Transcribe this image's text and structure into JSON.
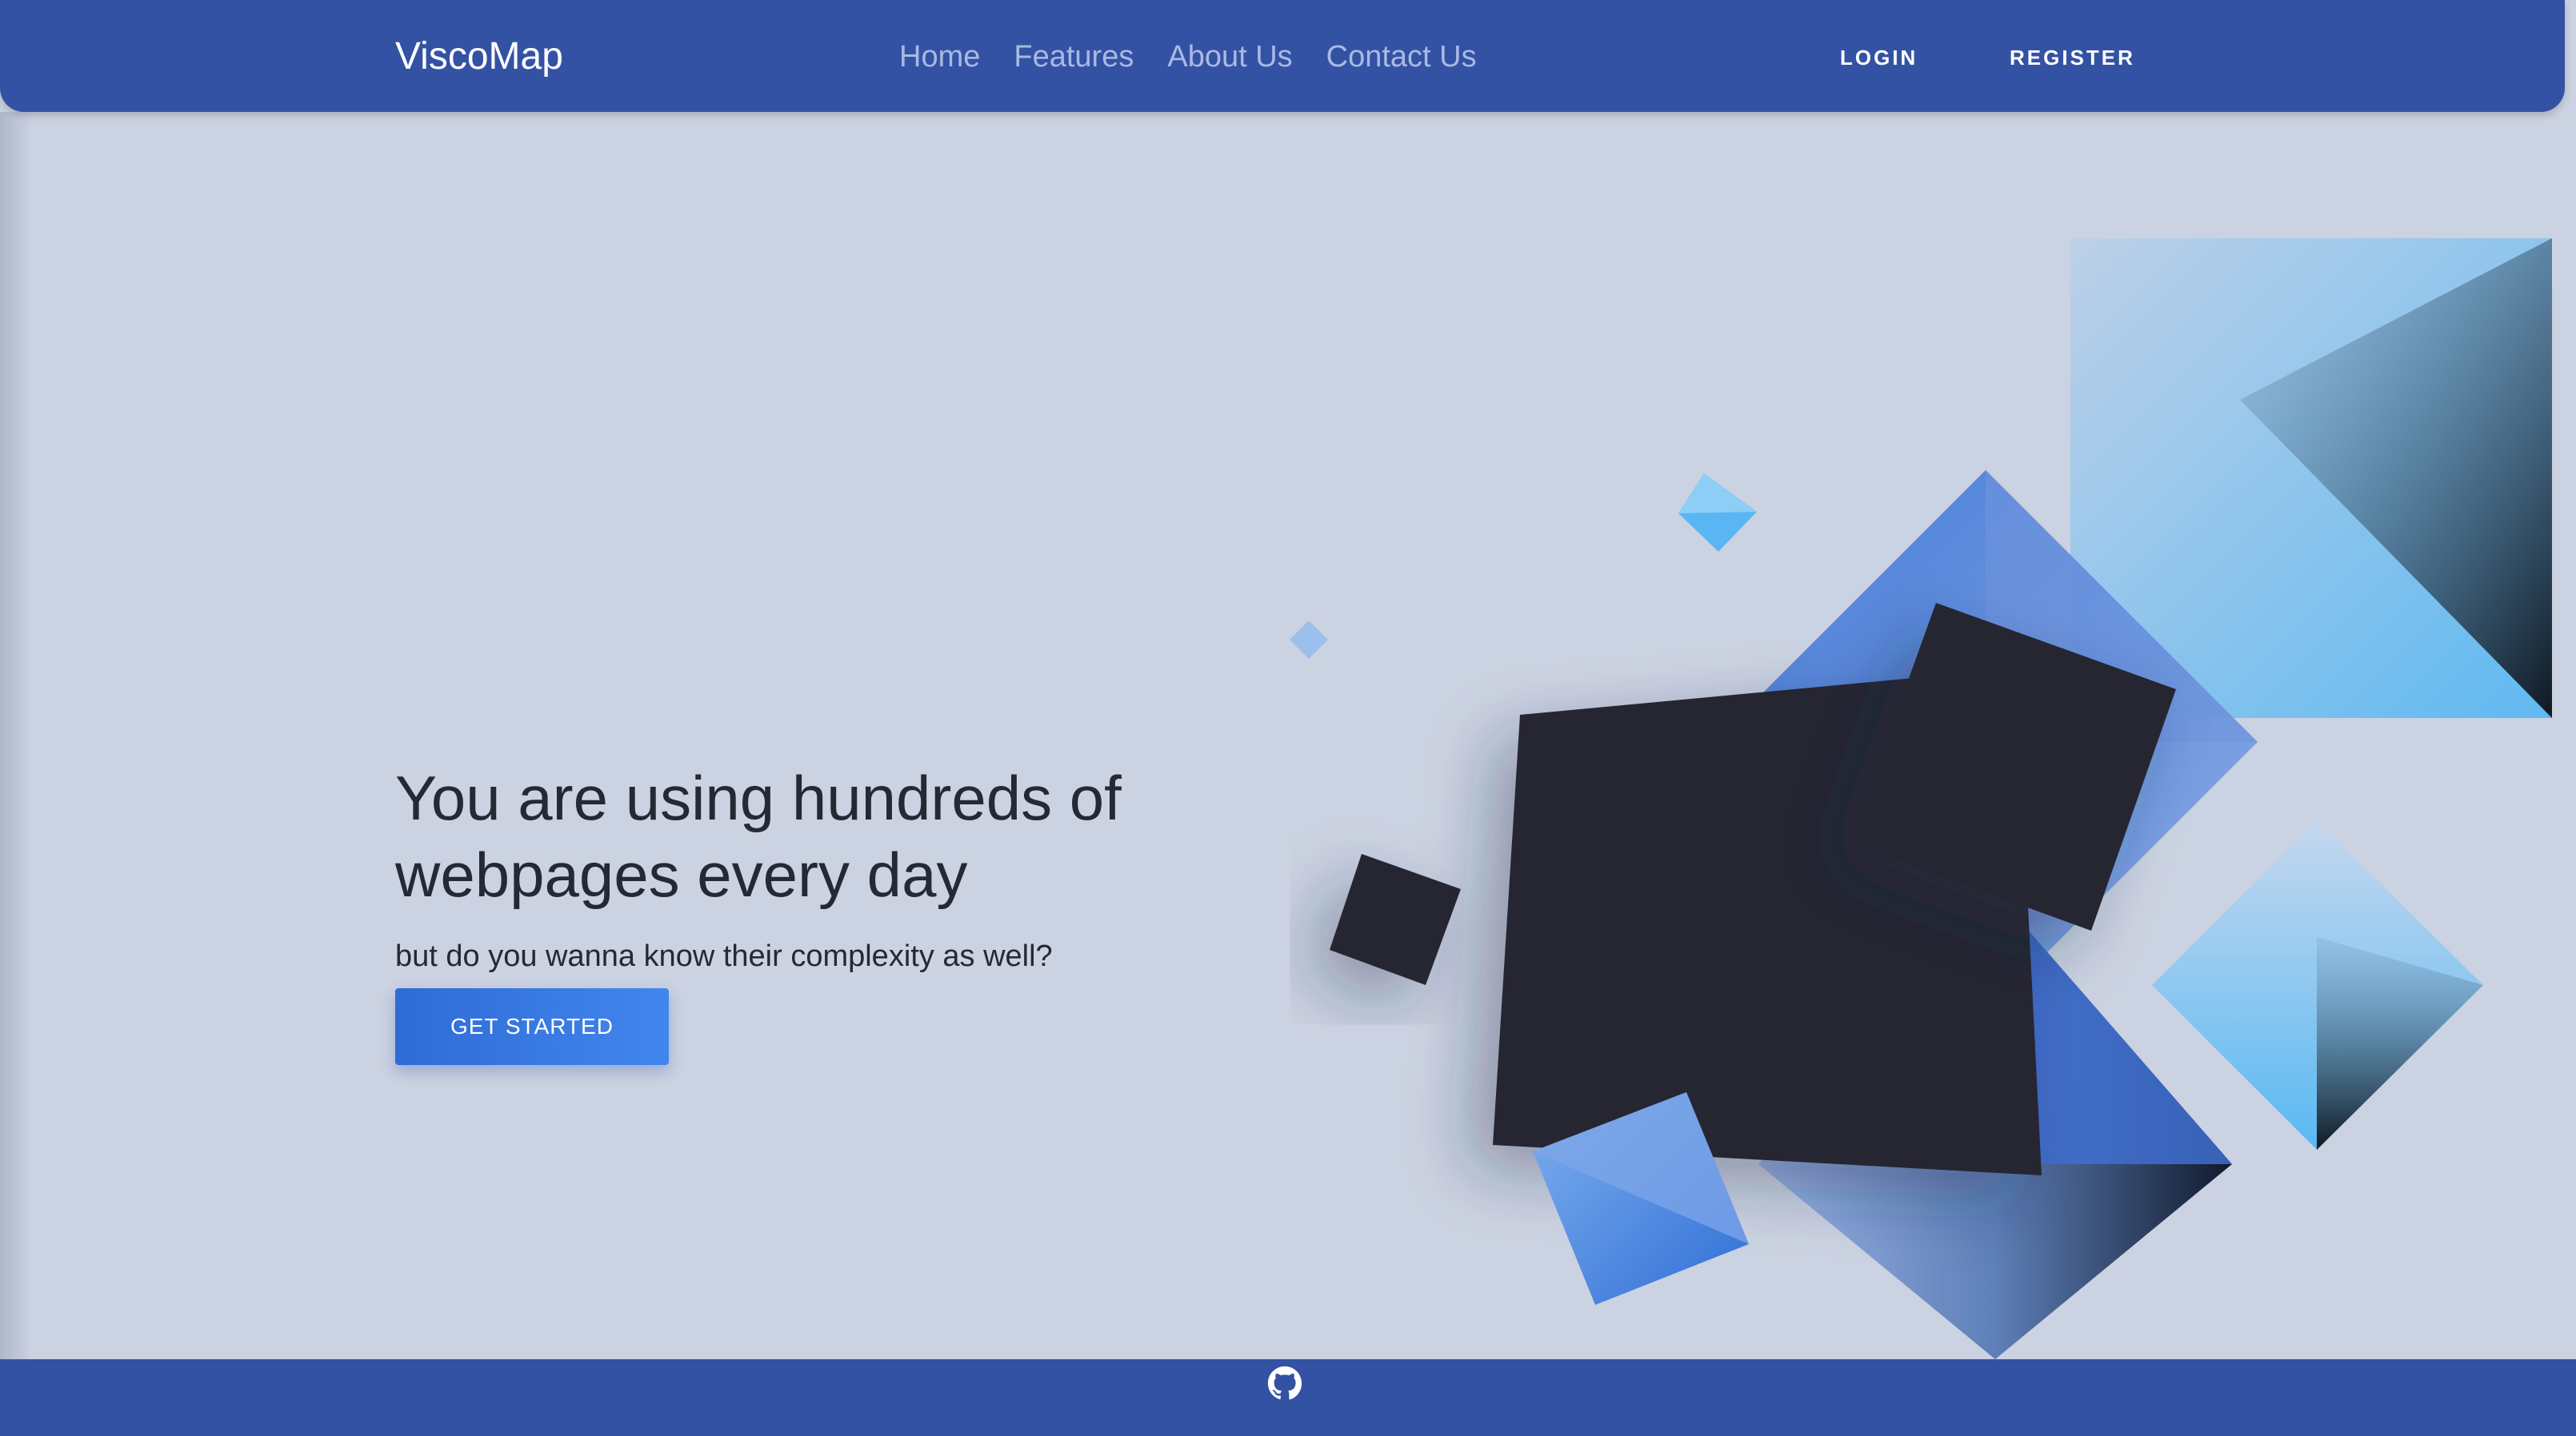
{
  "brand": {
    "name": "ViscoMap"
  },
  "nav": {
    "links": [
      {
        "label": "Home"
      },
      {
        "label": "Features"
      },
      {
        "label": "About Us"
      },
      {
        "label": "Contact Us"
      }
    ],
    "login": "LOGIN",
    "register": "REGISTER"
  },
  "hero": {
    "title": "You are using hundreds of webpages every day",
    "subtitle": "but do you wanna know their complexity as well?",
    "cta": "GET STARTED"
  },
  "footer": {
    "icon": "github-icon"
  },
  "colors": {
    "primary": "#3452a4",
    "background": "#cbd2e1",
    "accent": "#3b7ae3",
    "dark": "#252831",
    "nav_link": "#a9b9e2"
  }
}
